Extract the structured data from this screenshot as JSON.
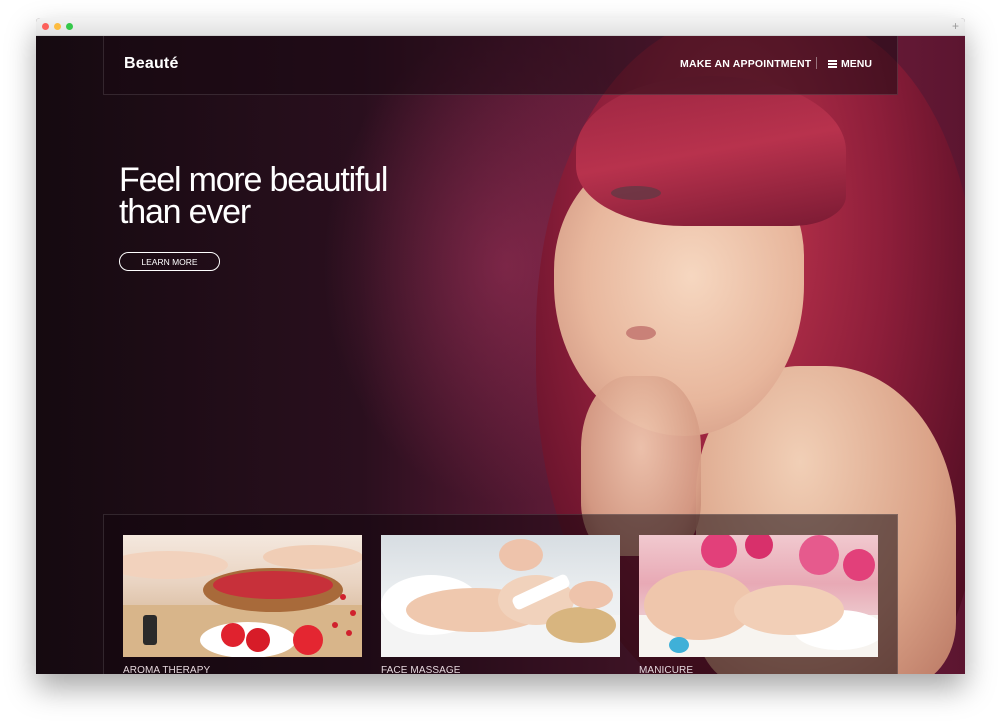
{
  "window": {
    "plus_glyph": "+"
  },
  "header": {
    "logo": "Beauté",
    "appointment_label": "MAKE AN APPOINTMENT",
    "menu_label": "MENU"
  },
  "hero": {
    "title_line1": "Feel more beautiful",
    "title_line2": "than ever",
    "cta_label": "LEARN MORE"
  },
  "services": [
    {
      "label": "AROMA THERAPY"
    },
    {
      "label": "FACE MASSAGE"
    },
    {
      "label": "MANICURE"
    }
  ],
  "colors": {
    "brand_dark": "#150a10",
    "accent_hair": "#8d1e3a",
    "text": "#ffffff"
  }
}
